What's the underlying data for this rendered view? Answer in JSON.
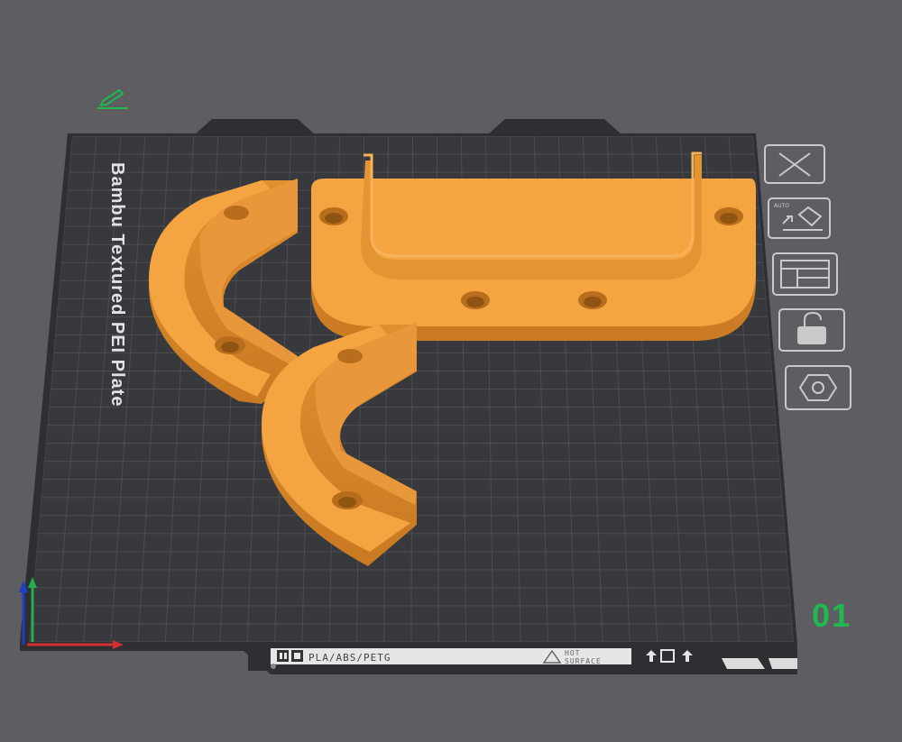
{
  "plate": {
    "name": "Bambu Textured PEI Plate",
    "number": "01",
    "material_label": "PLA/ABS/PETG",
    "hot_surface_line1": "HOT",
    "hot_surface_line2": "SURFACE"
  },
  "plate_toolbar": [
    {
      "id": "delete",
      "icon": "close-icon"
    },
    {
      "id": "auto-orient",
      "icon": "auto-orient-icon",
      "label": "AUTO"
    },
    {
      "id": "arrange",
      "icon": "arrange-icon"
    },
    {
      "id": "lock",
      "icon": "lock-icon"
    },
    {
      "id": "plate-settings",
      "icon": "hexagon-nut-icon"
    }
  ],
  "edit_name_icon": "pencil-icon",
  "colors": {
    "background": "#5d5d62",
    "plate": "#333438",
    "grid": "#4a4b50",
    "model": "#f5a442",
    "plate_number": "#1fb94f",
    "axis_x": "#d32f2f",
    "axis_y": "#22b24c",
    "axis_z": "#1e3fbf"
  }
}
